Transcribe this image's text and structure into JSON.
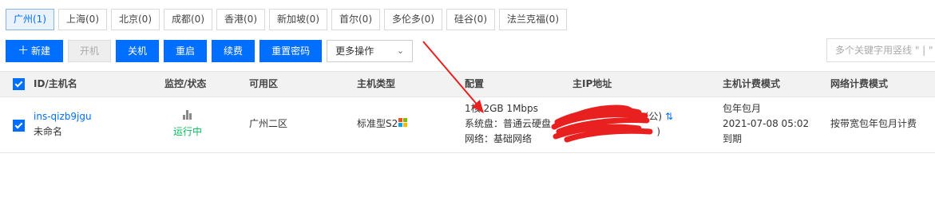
{
  "regions": [
    {
      "label": "广州(1)",
      "active": true
    },
    {
      "label": "上海(0)"
    },
    {
      "label": "北京(0)"
    },
    {
      "label": "成都(0)"
    },
    {
      "label": "香港(0)"
    },
    {
      "label": "新加坡(0)"
    },
    {
      "label": "首尔(0)"
    },
    {
      "label": "多伦多(0)"
    },
    {
      "label": "硅谷(0)"
    },
    {
      "label": "法兰克福(0)"
    }
  ],
  "toolbar": {
    "new_label": "新建",
    "power_on_label": "开机",
    "power_off_label": "关机",
    "restart_label": "重启",
    "renew_label": "续费",
    "reset_password_label": "重置密码",
    "more_actions_label": "更多操作"
  },
  "search": {
    "placeholder": "多个关键字用竖线 \" | \" 分"
  },
  "table": {
    "headers": {
      "id_name": "ID/主机名",
      "monitor_status": "监控/状态",
      "zone": "可用区",
      "type": "主机类型",
      "config": "配置",
      "primary_ip": "主IP地址",
      "billing_mode": "主机计费模式",
      "network_billing": "网络计费模式"
    },
    "rows": [
      {
        "id": "ins-qizb9jgu",
        "name": "未命名",
        "status": "运行中",
        "zone": "广州二区",
        "type": "标准型S2",
        "config_line1": "1核 2GB 1Mbps",
        "config_line2": "系统盘：普通云硬盘",
        "config_line3": "网络：基础网络",
        "ip_public_suffix": "(公)",
        "ip_private_suffix": ")",
        "billing_line1": "包年包月",
        "billing_line2": "2021-07-08 05:02",
        "billing_line3": "到期",
        "network_billing": "按带宽包年包月计费"
      }
    ]
  },
  "colors": {
    "accent": "#006eff",
    "running": "#0abf5b",
    "annotation_red": "#e8201f"
  }
}
